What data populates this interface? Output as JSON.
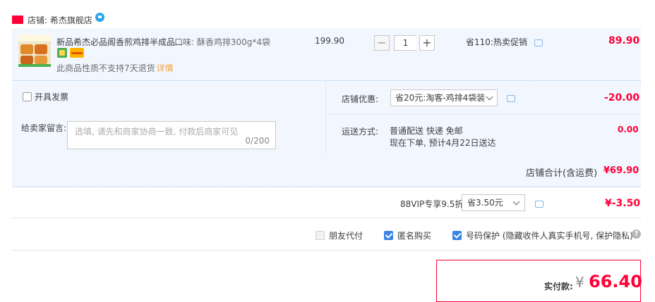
{
  "store": {
    "badge": "天猫",
    "label": "店铺: 希杰旗舰店"
  },
  "item": {
    "title": "新品希杰必品阁香煎鸡排半成品...",
    "spec": "口味: 酥香鸡排300g*4袋",
    "return_note": "此商品性质不支持7天退货",
    "return_link": "详情",
    "unit_price": "199.90",
    "quantity": "1",
    "minus": "−",
    "plus": "+",
    "promo": "省110:热卖促销",
    "total": "89.90"
  },
  "options": {
    "invoice_label": "开具发票",
    "memo_label": "给卖家留言:",
    "memo_placeholder": "选填, 请先和商家协商一致, 付款后商家可见",
    "memo_count": "0/200",
    "discount_label": "店铺优惠:",
    "discount_selected": "省20元:淘客-鸡排4袋装",
    "discount_amount": "-20.00",
    "ship_label": "运送方式:",
    "ship_method": "普通配送 快递 免邮",
    "ship_eta": "现在下单, 预计4月22日送达",
    "ship_fee": "0.00"
  },
  "store_total": {
    "label": "店铺合计(含运费)",
    "value": "¥69.90"
  },
  "vip": {
    "label": "88VIP专享9.5折",
    "selected": "省3.50元",
    "amount": "¥-3.50"
  },
  "flags": {
    "friend_pay": "朋友代付",
    "anonymous": "匿名购买",
    "privacy": "号码保护 (隐藏收件人真实手机号, 保护隐私)",
    "help": "?"
  },
  "payment": {
    "label": "实付款:",
    "currency": "¥",
    "amount": "66.40"
  },
  "colors": {
    "accent_red": "#ff0036",
    "panel_bg": "#f2f7ff",
    "checkbox_blue": "#3a84e6"
  }
}
